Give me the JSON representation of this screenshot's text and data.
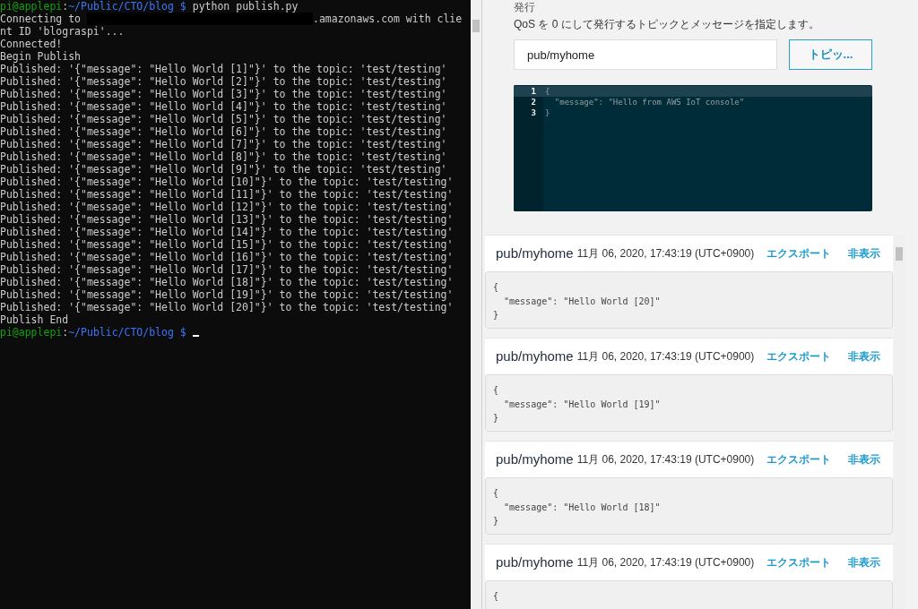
{
  "terminal": {
    "lines": [
      {
        "kind": "prompt",
        "user": "pi@applepi",
        "separator": ":",
        "path": "~/Public/CTO/blog $",
        "command": "python publish.py",
        "cursor": false
      },
      {
        "kind": "redacted",
        "before": "Connecting to",
        "after": ".amazonaws.com with clie"
      },
      {
        "kind": "plain",
        "text": "nt ID 'blograspi'..."
      },
      {
        "kind": "plain",
        "text": "Connected!"
      },
      {
        "kind": "plain",
        "text": "Begin Publish"
      },
      {
        "kind": "plain",
        "text": "Published: '{\"message\": \"Hello World [1]\"}' to the topic: 'test/testing'"
      },
      {
        "kind": "plain",
        "text": "Published: '{\"message\": \"Hello World [2]\"}' to the topic: 'test/testing'"
      },
      {
        "kind": "plain",
        "text": "Published: '{\"message\": \"Hello World [3]\"}' to the topic: 'test/testing'"
      },
      {
        "kind": "plain",
        "text": "Published: '{\"message\": \"Hello World [4]\"}' to the topic: 'test/testing'"
      },
      {
        "kind": "plain",
        "text": "Published: '{\"message\": \"Hello World [5]\"}' to the topic: 'test/testing'"
      },
      {
        "kind": "plain",
        "text": "Published: '{\"message\": \"Hello World [6]\"}' to the topic: 'test/testing'"
      },
      {
        "kind": "plain",
        "text": "Published: '{\"message\": \"Hello World [7]\"}' to the topic: 'test/testing'"
      },
      {
        "kind": "plain",
        "text": "Published: '{\"message\": \"Hello World [8]\"}' to the topic: 'test/testing'"
      },
      {
        "kind": "plain",
        "text": "Published: '{\"message\": \"Hello World [9]\"}' to the topic: 'test/testing'"
      },
      {
        "kind": "plain",
        "text": "Published: '{\"message\": \"Hello World [10]\"}' to the topic: 'test/testing'"
      },
      {
        "kind": "plain",
        "text": "Published: '{\"message\": \"Hello World [11]\"}' to the topic: 'test/testing'"
      },
      {
        "kind": "plain",
        "text": "Published: '{\"message\": \"Hello World [12]\"}' to the topic: 'test/testing'"
      },
      {
        "kind": "plain",
        "text": "Published: '{\"message\": \"Hello World [13]\"}' to the topic: 'test/testing'"
      },
      {
        "kind": "plain",
        "text": "Published: '{\"message\": \"Hello World [14]\"}' to the topic: 'test/testing'"
      },
      {
        "kind": "plain",
        "text": "Published: '{\"message\": \"Hello World [15]\"}' to the topic: 'test/testing'"
      },
      {
        "kind": "plain",
        "text": "Published: '{\"message\": \"Hello World [16]\"}' to the topic: 'test/testing'"
      },
      {
        "kind": "plain",
        "text": "Published: '{\"message\": \"Hello World [17]\"}' to the topic: 'test/testing'"
      },
      {
        "kind": "plain",
        "text": "Published: '{\"message\": \"Hello World [18]\"}' to the topic: 'test/testing'"
      },
      {
        "kind": "plain",
        "text": "Published: '{\"message\": \"Hello World [19]\"}' to the topic: 'test/testing'"
      },
      {
        "kind": "plain",
        "text": "Published: '{\"message\": \"Hello World [20]\"}' to the topic: 'test/testing'"
      },
      {
        "kind": "plain",
        "text": "Publish End"
      },
      {
        "kind": "prompt",
        "user": "pi@applepi",
        "separator": ":",
        "path": "~/Public/CTO/blog $",
        "cursor": true
      }
    ]
  },
  "publish": {
    "heading": "発行",
    "description": "QoS を 0 にして発行するトピックとメッセージを指定します。",
    "topic": "pub/myhome",
    "button": "トピッ...",
    "editor": [
      {
        "number": "1",
        "code": "{",
        "selected": true
      },
      {
        "number": "2",
        "code": "  \"message\": \"Hello from AWS IoT console\"",
        "selected": false
      },
      {
        "number": "3",
        "code": "}",
        "selected": false
      }
    ]
  },
  "messages": [
    {
      "topic": "pub/myhome",
      "time": "11月 06, 2020, 17:43:19 (UTC+0900)",
      "export": "エクスポート",
      "hide": "非表示",
      "body": [
        "{",
        "  \"message\": \"Hello World [20]\"",
        "}"
      ]
    },
    {
      "topic": "pub/myhome",
      "time": "11月 06, 2020, 17:43:19 (UTC+0900)",
      "export": "エクスポート",
      "hide": "非表示",
      "body": [
        "{",
        "  \"message\": \"Hello World [19]\"",
        "}"
      ]
    },
    {
      "topic": "pub/myhome",
      "time": "11月 06, 2020, 17:43:19 (UTC+0900)",
      "export": "エクスポート",
      "hide": "非表示",
      "body": [
        "{",
        "  \"message\": \"Hello World [18]\"",
        "}"
      ]
    },
    {
      "topic": "pub/myhome",
      "time": "11月 06, 2020, 17:43:19 (UTC+0900)",
      "export": "エクスポート",
      "hide": "非表示",
      "body": [
        "{"
      ]
    }
  ]
}
